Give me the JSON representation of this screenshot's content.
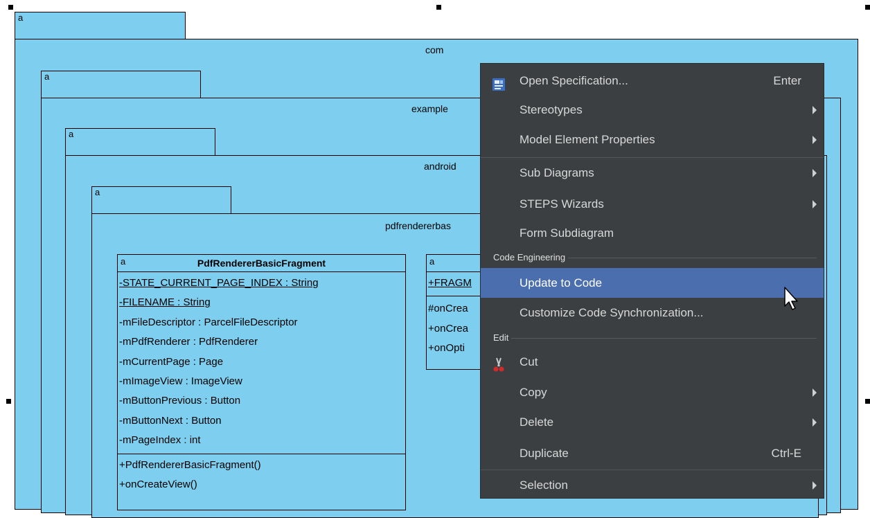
{
  "diagram": {
    "packages": [
      {
        "tab": "a",
        "name": "com"
      },
      {
        "tab": "a",
        "name": "example"
      },
      {
        "tab": "a",
        "name": "android"
      },
      {
        "tab": "a",
        "name": "pdfrendererbas"
      }
    ],
    "class_main": {
      "tab": "a",
      "title": "PdfRendererBasicFragment",
      "static_attributes": [
        "-STATE_CURRENT_PAGE_INDEX : String",
        "-FILENAME : String"
      ],
      "attributes": [
        "-mFileDescriptor : ParcelFileDescriptor",
        "-mPdfRenderer : PdfRenderer",
        "-mCurrentPage : Page",
        "-mImageView : ImageView",
        "-mButtonPrevious : Button",
        "-mButtonNext : Button",
        "-mPageIndex : int"
      ],
      "operations": [
        "+PdfRendererBasicFragment()",
        "+onCreateView()"
      ]
    },
    "class_second": {
      "tab": "a",
      "attributes": [
        "+FRAGM"
      ],
      "operations": [
        "#onCrea",
        "+onCrea",
        "+onOpti"
      ]
    }
  },
  "context_menu": {
    "items_top": [
      {
        "label": "Open Specification...",
        "shortcut": "Enter",
        "icon": "specification-icon"
      },
      {
        "label": "Stereotypes",
        "submenu": true
      },
      {
        "label": "Model Element Properties",
        "submenu": true
      },
      {
        "label": "Sub Diagrams",
        "submenu": true
      },
      {
        "label": "STEPS Wizards",
        "submenu": true
      },
      {
        "label": "Form Subdiagram"
      }
    ],
    "section_code": "Code Engineering",
    "items_code": [
      {
        "label": "Update to Code",
        "highlighted": true
      },
      {
        "label": "Customize Code Synchronization..."
      }
    ],
    "section_edit": "Edit",
    "items_edit": [
      {
        "label": "Cut",
        "icon": "scissors-icon"
      },
      {
        "label": "Copy",
        "submenu": true
      },
      {
        "label": "Delete",
        "submenu": true
      },
      {
        "label": "Duplicate",
        "shortcut": "Ctrl-E"
      }
    ],
    "items_bottom": [
      {
        "label": "Selection",
        "submenu": true
      }
    ]
  },
  "colors": {
    "package_fill": "#7ecfef",
    "menu_bg": "#3c3f41",
    "menu_highlight": "#4b6eaf",
    "menu_text": "#d8d8d8"
  }
}
